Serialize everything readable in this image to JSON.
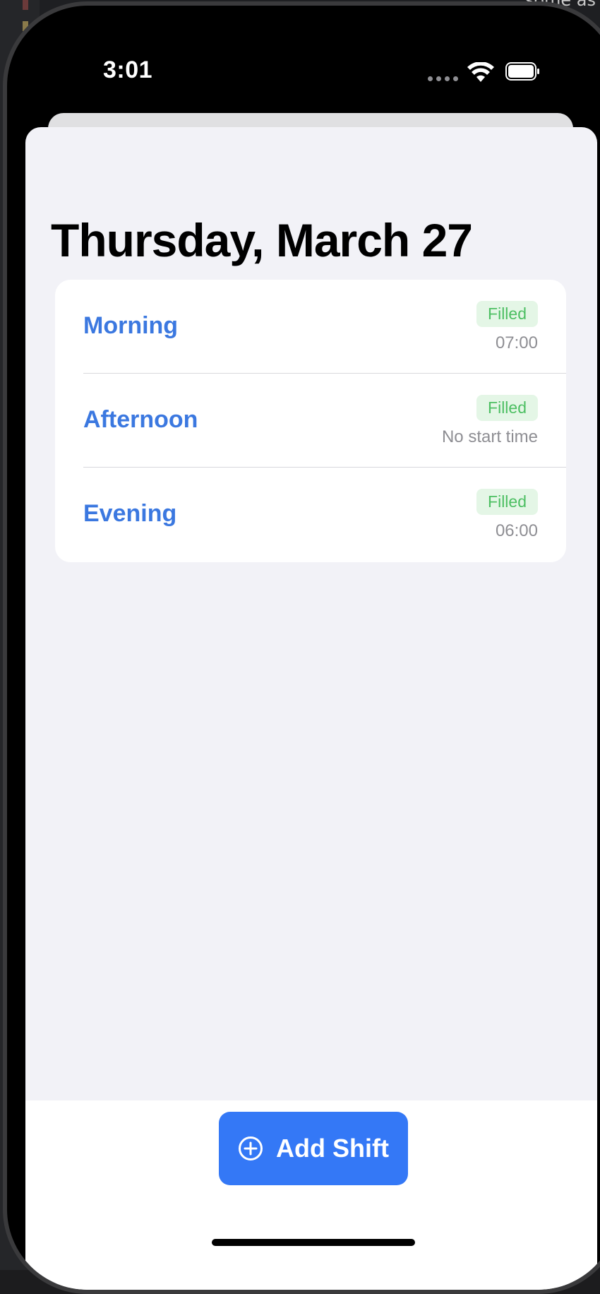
{
  "status_bar": {
    "time": "3:01"
  },
  "background": {
    "peek_text": "some as"
  },
  "page": {
    "title": "Thursday, March 27"
  },
  "shifts": [
    {
      "name": "Morning",
      "status": "Filled",
      "start_time": "07:00"
    },
    {
      "name": "Afternoon",
      "status": "Filled",
      "start_time": "No start time"
    },
    {
      "name": "Evening",
      "status": "Filled",
      "start_time": "06:00"
    }
  ],
  "actions": {
    "add_shift_label": "Add Shift",
    "add_shift_icon": "plus-circle-icon"
  },
  "colors": {
    "accent": "#3478f6",
    "shift_name": "#3b78e0",
    "filled_badge_text": "#4cbf62",
    "filled_badge_bg": "#e4f6e6",
    "sheet_background": "#f2f2f7"
  }
}
